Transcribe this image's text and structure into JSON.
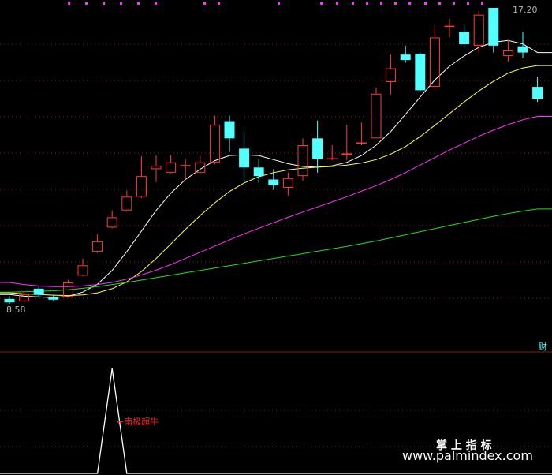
{
  "chart_data": {
    "type": "candlestick",
    "price_high_label": "17.20",
    "price_low_label": "8.58",
    "panel_tag": "财",
    "colors": {
      "background": "#000000",
      "up_candle": "#ff3b3b",
      "down_candle": "#54ffff",
      "ma_fast": "#ffffff",
      "ma_mid": "#ffff55",
      "ma_slow": "#ff33ff",
      "ma_long": "#22dd22",
      "indicator": "#ffffff",
      "annotation": "#ff2020",
      "grid": "#8b1a1a",
      "marker": "#ff33ff"
    },
    "candles": [
      {
        "o": 8.72,
        "c": 8.62,
        "h": 8.8,
        "l": 8.58
      },
      {
        "o": 8.65,
        "c": 8.85,
        "h": 8.92,
        "l": 8.62
      },
      {
        "o": 9.02,
        "c": 8.84,
        "h": 9.08,
        "l": 8.78
      },
      {
        "o": 8.78,
        "c": 8.7,
        "h": 8.82,
        "l": 8.66
      },
      {
        "o": 8.78,
        "c": 9.2,
        "h": 9.28,
        "l": 8.76
      },
      {
        "o": 9.4,
        "c": 9.7,
        "h": 9.9,
        "l": 9.38
      },
      {
        "o": 10.1,
        "c": 10.4,
        "h": 10.6,
        "l": 10.06
      },
      {
        "o": 10.8,
        "c": 11.1,
        "h": 11.3,
        "l": 10.78
      },
      {
        "o": 11.3,
        "c": 11.7,
        "h": 11.88,
        "l": 11.26
      },
      {
        "o": 11.7,
        "c": 12.3,
        "h": 12.88,
        "l": 11.66
      },
      {
        "o": 12.5,
        "c": 12.6,
        "h": 12.9,
        "l": 12.12
      },
      {
        "o": 12.4,
        "c": 12.7,
        "h": 12.9,
        "l": 12.38
      },
      {
        "o": 12.6,
        "c": 12.62,
        "h": 12.8,
        "l": 12.2
      },
      {
        "o": 12.4,
        "c": 12.7,
        "h": 12.9,
        "l": 12.38
      },
      {
        "o": 12.7,
        "c": 13.8,
        "h": 14.06,
        "l": 12.64
      },
      {
        "o": 13.9,
        "c": 13.4,
        "h": 14.06,
        "l": 13.0
      },
      {
        "o": 13.1,
        "c": 12.55,
        "h": 13.6,
        "l": 12.1
      },
      {
        "o": 12.55,
        "c": 12.3,
        "h": 12.8,
        "l": 12.1
      },
      {
        "o": 12.2,
        "c": 12.04,
        "h": 12.5,
        "l": 11.9
      },
      {
        "o": 11.96,
        "c": 12.24,
        "h": 12.4,
        "l": 11.74
      },
      {
        "o": 12.3,
        "c": 13.2,
        "h": 13.4,
        "l": 12.16
      },
      {
        "o": 13.4,
        "c": 12.8,
        "h": 13.92,
        "l": 12.4
      },
      {
        "o": 12.8,
        "c": 12.82,
        "h": 13.2,
        "l": 12.76
      },
      {
        "o": 12.92,
        "c": 12.96,
        "h": 13.8,
        "l": 12.76
      },
      {
        "o": 13.26,
        "c": 13.28,
        "h": 13.86,
        "l": 13.2
      },
      {
        "o": 13.4,
        "c": 14.7,
        "h": 14.88,
        "l": 13.4
      },
      {
        "o": 15.04,
        "c": 15.44,
        "h": 15.84,
        "l": 14.68
      },
      {
        "o": 15.84,
        "c": 15.68,
        "h": 16.1,
        "l": 15.6
      },
      {
        "o": 15.86,
        "c": 14.8,
        "h": 15.9,
        "l": 14.76
      },
      {
        "o": 14.9,
        "c": 16.34,
        "h": 16.7,
        "l": 14.8
      },
      {
        "o": 16.66,
        "c": 16.68,
        "h": 16.88,
        "l": 16.34
      },
      {
        "o": 16.5,
        "c": 16.14,
        "h": 16.7,
        "l": 16.04
      },
      {
        "o": 16.1,
        "c": 17.0,
        "h": 17.1,
        "l": 15.9
      },
      {
        "o": 17.2,
        "c": 16.1,
        "h": 17.2,
        "l": 15.9
      },
      {
        "o": 15.8,
        "c": 15.96,
        "h": 16.26,
        "l": 15.64
      },
      {
        "o": 16.08,
        "c": 15.9,
        "h": 16.5,
        "l": 15.74
      },
      {
        "o": 14.9,
        "c": 14.55,
        "h": 15.2,
        "l": 14.46
      }
    ],
    "moving_averages": [
      {
        "key": "ma_fast",
        "values": [
          8.85,
          8.8,
          8.78,
          8.76,
          8.8,
          8.92,
          9.15,
          9.55,
          10.1,
          10.7,
          11.3,
          11.8,
          12.2,
          12.5,
          12.75,
          12.9,
          12.92,
          12.9,
          12.78,
          12.66,
          12.58,
          12.56,
          12.6,
          12.7,
          12.9,
          13.2,
          13.6,
          14.1,
          14.6,
          15.1,
          15.5,
          15.8,
          16.05,
          16.2,
          16.25,
          16.15,
          15.9
        ]
      },
      {
        "key": "ma_mid",
        "values": [
          8.9,
          8.87,
          8.85,
          8.83,
          8.82,
          8.84,
          8.9,
          9.02,
          9.22,
          9.52,
          9.9,
          10.32,
          10.75,
          11.15,
          11.52,
          11.85,
          12.1,
          12.28,
          12.4,
          12.48,
          12.53,
          12.56,
          12.58,
          12.62,
          12.68,
          12.78,
          12.94,
          13.16,
          13.45,
          13.78,
          14.12,
          14.46,
          14.78,
          15.06,
          15.3,
          15.45,
          15.52
        ]
      },
      {
        "key": "ma_slow",
        "values": [
          9.2,
          9.14,
          9.1,
          9.08,
          9.08,
          9.1,
          9.14,
          9.2,
          9.3,
          9.42,
          9.56,
          9.72,
          9.9,
          10.08,
          10.26,
          10.44,
          10.62,
          10.78,
          10.94,
          11.1,
          11.25,
          11.4,
          11.55,
          11.7,
          11.86,
          12.02,
          12.2,
          12.4,
          12.62,
          12.84,
          13.06,
          13.26,
          13.46,
          13.64,
          13.8,
          13.94,
          14.04
        ]
      },
      {
        "key": "ma_long",
        "values": [
          8.92,
          8.93,
          8.94,
          8.96,
          8.99,
          9.03,
          9.08,
          9.14,
          9.2,
          9.27,
          9.34,
          9.41,
          9.48,
          9.55,
          9.62,
          9.69,
          9.76,
          9.83,
          9.9,
          9.97,
          10.04,
          10.11,
          10.18,
          10.25,
          10.33,
          10.41,
          10.5,
          10.59,
          10.68,
          10.77,
          10.86,
          10.95,
          11.04,
          11.13,
          11.21,
          11.28,
          11.34
        ]
      }
    ],
    "indicator": {
      "values": [
        0,
        0,
        0,
        0,
        0,
        0,
        0,
        1,
        0,
        0,
        0,
        0,
        0,
        0,
        0,
        0,
        0,
        0,
        0,
        0,
        0,
        0,
        0,
        0,
        0,
        0,
        0,
        0,
        0,
        0,
        0,
        0,
        0,
        0,
        0,
        0,
        0
      ],
      "annotation": "←南极超牛"
    },
    "watermark": {
      "line1": "掌 上 指 标",
      "line2": "www.palmindex.com"
    }
  }
}
